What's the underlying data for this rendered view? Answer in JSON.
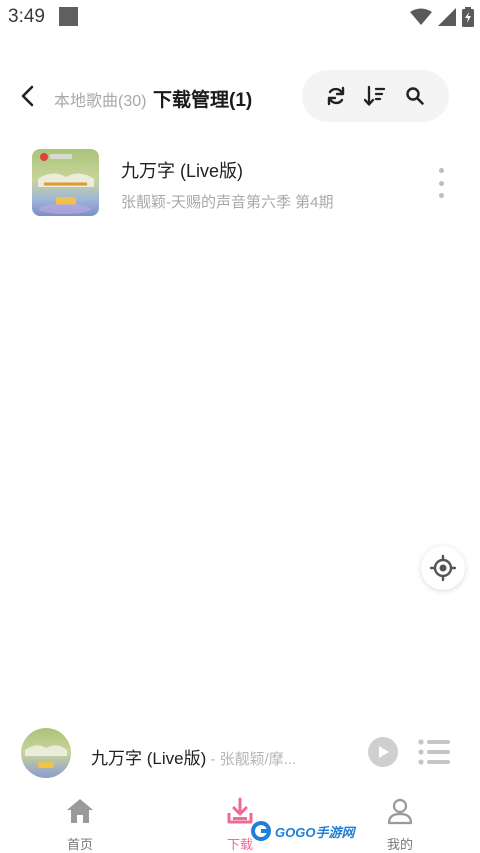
{
  "status_bar": {
    "time": "3:49"
  },
  "header": {
    "tab_local": "本地歌曲(30)",
    "tab_download": "下载管理(1)"
  },
  "songs": [
    {
      "title": "九万字 (Live版)",
      "subtitle": "张靓颖-天赐的声音第六季 第4期"
    }
  ],
  "mini_player": {
    "title": "九万字 (Live版)",
    "artist": " - 张靓颖/摩..."
  },
  "bottom_nav": {
    "items": [
      {
        "label": "首页",
        "icon": "home-icon"
      },
      {
        "label": "下载",
        "icon": "download-icon",
        "active": true
      },
      {
        "label": "我的",
        "icon": "profile-icon"
      }
    ]
  },
  "watermark": {
    "text": "GOGO手游网"
  },
  "colors": {
    "accent": "#f06a95",
    "pill_bg": "#f4f4f4",
    "muted": "#a9a9a9"
  }
}
